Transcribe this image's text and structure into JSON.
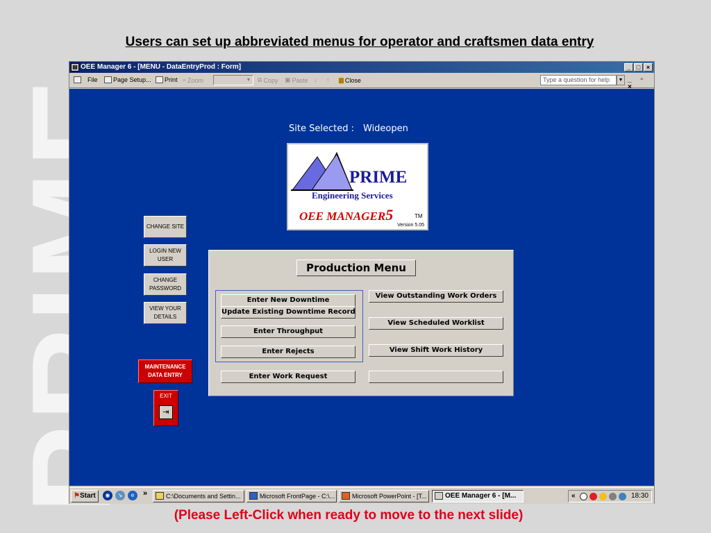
{
  "slide": {
    "title": "Users can set up abbreviated menus for operator and craftsmen data entry",
    "footer": "(Please Left-Click when ready to move to the next slide)",
    "watermark": "PRIME"
  },
  "window": {
    "title": "OEE Manager 6 - [MENU - DataEntryProd : Form]",
    "controls": {
      "minimize": "_",
      "maximize": "□",
      "close": "×"
    }
  },
  "toolbar": {
    "file": "File",
    "page_setup": "Page Setup...",
    "print": "Print",
    "zoom": "Zoom",
    "copy": "Copy",
    "paste": "Paste",
    "close": "Close",
    "help_placeholder": "Type a question for help",
    "mdi_controls": "_ ▫ ×"
  },
  "form": {
    "site_label": "Site Selected :",
    "site_value": "Wideopen",
    "logo": {
      "prime": "PRIME",
      "engineering": "Engineering Services",
      "oee": "OEE MANAGER",
      "oee_number": "5",
      "tm": "TM",
      "version": "Version 5.05"
    },
    "side_buttons": [
      "CHANGE SITE",
      "LOGIN NEW USER",
      "CHANGE PASSWORD",
      "VIEW YOUR DETAILS",
      "MAINTENANCE DATA ENTRY"
    ],
    "exit_label": "EXIT",
    "production_menu": {
      "title": "Production Menu",
      "left_buttons": [
        "Enter New Downtime",
        "Update Existing Downtime Record",
        "Enter Throughput",
        "Enter Rejects",
        "Enter Work Request"
      ],
      "right_buttons": [
        "View Outstanding Work Orders",
        "View Scheduled Worklist",
        "View Shift Work History",
        ""
      ]
    }
  },
  "taskbar": {
    "start": "Start",
    "chevron": "»",
    "tasks": [
      "C:\\Documents and Settin...",
      "Microsoft FrontPage - C:\\...",
      "Microsoft PowerPoint - [T...",
      "OEE Manager 6 - [M..."
    ],
    "tray_chevron": "«",
    "clock": "18:30"
  },
  "colors": {
    "form_bg": "#003399",
    "title_accent": "#e0001a",
    "maintenance_button": "#cc0000"
  }
}
